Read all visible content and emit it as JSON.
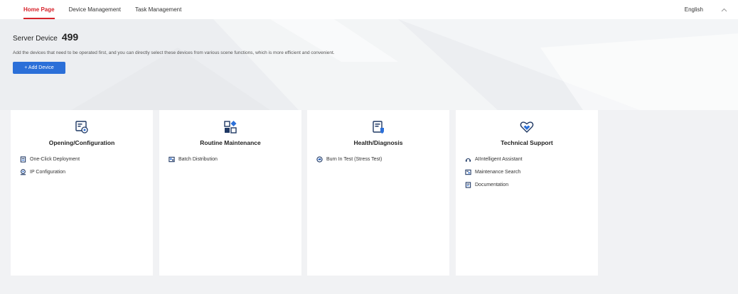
{
  "nav": {
    "tabs": [
      "Home Page",
      "Device Management",
      "Task Management"
    ],
    "active_tab": 0,
    "language": "English"
  },
  "hero": {
    "label": "Server Device",
    "count": "499",
    "description": "Add the devices that need to be operated first, and you can directly select these devices from various scene functions, which is more efficient and convenient.",
    "add_button": "+ Add Device"
  },
  "cards": [
    {
      "title": "Opening/Configuration",
      "icon": "configuration-icon",
      "links": [
        {
          "label": "One-Click Deployment",
          "icon": "deployment-icon"
        },
        {
          "label": "IP Configuration",
          "icon": "ip-config-icon"
        }
      ]
    },
    {
      "title": "Routine Maintenance",
      "icon": "maintenance-icon",
      "links": [
        {
          "label": "Batch Distribution",
          "icon": "batch-distribution-icon"
        }
      ]
    },
    {
      "title": "Health/Diagnosis",
      "icon": "diagnosis-icon",
      "links": [
        {
          "label": "Burn In Test (Stress Test)",
          "icon": "stress-test-icon"
        }
      ]
    },
    {
      "title": "Technical Support",
      "icon": "heart-support-icon",
      "links": [
        {
          "label": "AIIntelligent Assistant",
          "icon": "assistant-icon"
        },
        {
          "label": "Maintenance Search",
          "icon": "search-doc-icon"
        },
        {
          "label": "Documentation",
          "icon": "documentation-icon"
        }
      ]
    }
  ],
  "colors": {
    "accent_red": "#d7232b",
    "primary_blue": "#2b6fd8",
    "icon_navy": "#1f3864"
  }
}
